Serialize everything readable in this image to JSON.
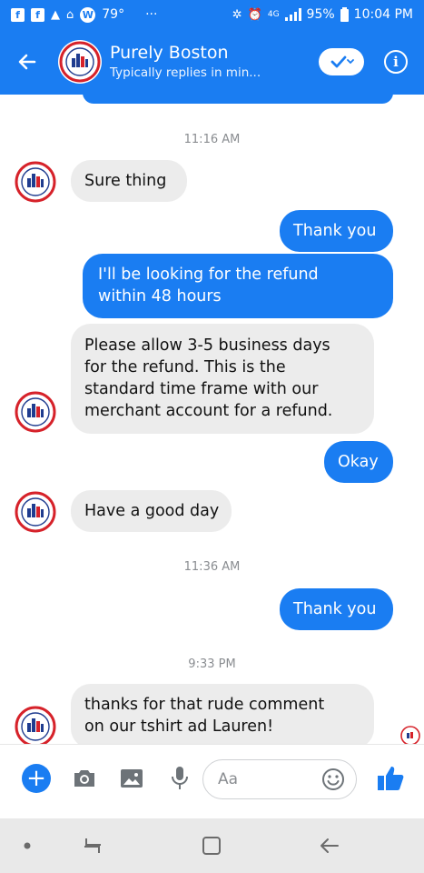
{
  "status_bar": {
    "temperature": "79°",
    "weather_badge": "W",
    "battery": "95%",
    "time": "10:04 PM",
    "network": "4G",
    "more": "···"
  },
  "header": {
    "title": "Purely Boston",
    "subtitle": "Typically replies in min...",
    "accent_color": "#1a7df2"
  },
  "logo": {
    "top_text": "PURELY",
    "bottom_text": "BOSTON"
  },
  "messages": [
    {
      "type": "timestamp",
      "text": "11:16 AM"
    },
    {
      "type": "incoming",
      "text": "Sure thing"
    },
    {
      "type": "outgoing",
      "text": "Thank you"
    },
    {
      "type": "outgoing",
      "lines": [
        "I'll be looking for the refund",
        "within 48 hours"
      ]
    },
    {
      "type": "incoming",
      "lines": [
        "Please allow 3-5 business days",
        "for the refund. This is the",
        "standard time frame with our",
        "merchant account for a refund."
      ]
    },
    {
      "type": "outgoing",
      "text": "Okay"
    },
    {
      "type": "incoming",
      "text": "Have a good day"
    },
    {
      "type": "timestamp",
      "text": "11:36 AM"
    },
    {
      "type": "outgoing",
      "text": "Thank you"
    },
    {
      "type": "timestamp",
      "text": "9:33 PM"
    },
    {
      "type": "incoming",
      "lines": [
        "thanks for that rude comment",
        "on our tshirt ad Lauren!"
      ]
    }
  ],
  "composer": {
    "placeholder": "Aa",
    "icons": [
      "plus-icon",
      "camera-icon",
      "image-icon",
      "microphone-icon",
      "emoji-icon",
      "thumbs-up-icon"
    ]
  },
  "nav_bar": {
    "icons": [
      "dot-icon",
      "recent-apps-icon",
      "home-icon",
      "back-icon"
    ]
  }
}
